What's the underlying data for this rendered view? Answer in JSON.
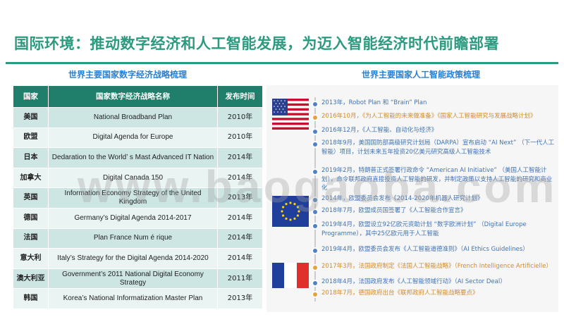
{
  "title": "国际环境：推动数字经济和人工智能发展，为迈入智能经济时代前瞻部署",
  "left_subtitle": "世界主要国家数字经济战略梳理",
  "right_subtitle": "世界主要国家人工智能政策梳理",
  "table": {
    "headers": [
      "国家",
      "国家数字经济战略名称",
      "发布时间"
    ],
    "rows": [
      {
        "country": "美国",
        "strategy": "National Broadband Plan",
        "year": "2010年"
      },
      {
        "country": "欧盟",
        "strategy": "Digital Agenda for Europe",
        "year": "2010年"
      },
      {
        "country": "日本",
        "strategy": "Dedaration to the World’ s Mast Advanced IT Nation",
        "year": "2014年"
      },
      {
        "country": "加拿大",
        "strategy": "Digital Canada 150",
        "year": "2014年"
      },
      {
        "country": "英国",
        "strategy": "Information Economy Strategy of the United Kingdom",
        "year": "2013年"
      },
      {
        "country": "德国",
        "strategy": "Germany’s Digital Agenda 2014-2017",
        "year": "2014年"
      },
      {
        "country": "法国",
        "strategy": "Plan France Num é rique",
        "year": "2014年"
      },
      {
        "country": "意大利",
        "strategy": "Italy’s Strategy for the Digital Agenda 2014-2020",
        "year": "2014年"
      },
      {
        "country": "澳大利亚",
        "strategy": "Government’s 2011 National Digital Economy Strategy",
        "year": "2011年"
      },
      {
        "country": "韩国",
        "strategy": "Korea’s National Informatization Master Plan",
        "year": "2013年"
      }
    ]
  },
  "timeline": [
    {
      "text": "2013年，Robot Plan 和 “Brain” Plan",
      "color": "blue"
    },
    {
      "text": "2016年10月，《为人工智能的未来做准备》《国家人工智能研究与发展战略计划》",
      "color": "orange"
    },
    {
      "text": "2016年12月，《人工智能、自动化与经济》",
      "color": "blue"
    },
    {
      "text": "2018年9月，美国国防部高级研究计划局（DARPA）宣布启动 “AI Next” （下一代人工智能）项目，计划未来五年投资20亿美元研究高级人工智能技术",
      "color": "blue"
    },
    {
      "text": "2019年2月，特朗普正式签署行政命令 “American AI Initiative” （美国人工智能计划），命令联邦政府直接投资人工智能的研发，并制定政策以支持人工智能的研究和商业化",
      "color": "blue"
    },
    {
      "text": "2014年，欧盟委员会发布《2014-2020年机器人研究计划》",
      "color": "blue"
    },
    {
      "text": "2018年7月，欧盟成员国签署了《人工智能合作宣言》",
      "color": "blue"
    },
    {
      "text": "2019年4月，欧盟设立92亿欧元资助计划 “数字欧洲计划” （Digital Europe Programme），其中25亿欧元用于人工智能",
      "color": "blue"
    },
    {
      "text": "2019年4月，欧盟委员会发布《人工智能道德准则》（AI Ethics Guidelines）",
      "color": "blue"
    },
    {
      "text": "2017年3月，法国政府制定《法国人工智能战略》（French Intelligence Artificielle）",
      "color": "orange"
    },
    {
      "text": "2018年4月，法国政府发布《人工智能领域行动》（AI Sector Deal）",
      "color": "blue"
    },
    {
      "text": "2018年7月，德国政府出台《联邦政府人工智能战略要点》",
      "color": "orange"
    }
  ],
  "watermark": "www.baogaoba.com"
}
